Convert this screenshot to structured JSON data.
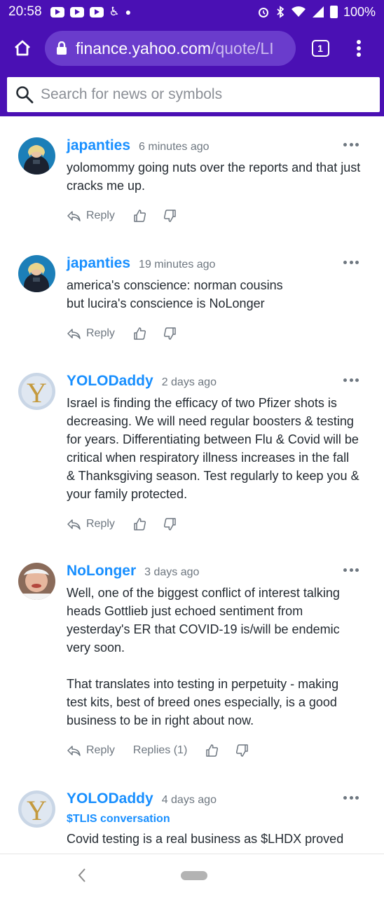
{
  "status_bar": {
    "time": "20:58",
    "battery": "100%",
    "icons": [
      "youtube-icon",
      "youtube-icon",
      "youtube-icon",
      "accessibility-icon",
      "dot-icon",
      "alarm-icon",
      "bluetooth-icon",
      "wifi-icon",
      "signal-icon",
      "battery-icon"
    ]
  },
  "browser": {
    "url_host": "finance.yahoo.com",
    "url_path": "/quote/LI",
    "tab_count": "1",
    "icons": {
      "home": "home-icon",
      "lock": "lock-icon",
      "menu": "kebab-menu-icon"
    }
  },
  "search": {
    "placeholder": "Search for news or symbols",
    "icon": "search-icon"
  },
  "colors": {
    "brand_purple": "#4a10b4",
    "username_blue": "#188fff",
    "muted_gray": "#6e7780"
  },
  "comments": [
    {
      "username": "japanties",
      "time": "6 minutes ago",
      "text": "yolomommy going nuts over the reports and that just cracks me up.",
      "reply_label": "Reply",
      "avatar": "performer-avatar"
    },
    {
      "username": "japanties",
      "time": "19 minutes ago",
      "text": "america's conscience: norman cousins\nbut lucira's conscience is NoLonger",
      "reply_label": "Reply",
      "avatar": "performer-avatar"
    },
    {
      "username": "YOLODaddy",
      "time": "2 days ago",
      "text": "Israel is finding the efficacy of two Pfizer shots is decreasing. We will need regular boosters & testing for years. Differentiating between Flu & Covid will be critical when respiratory illness increases in the fall & Thanksgiving season. Test regularly to keep you & your family protected.",
      "reply_label": "Reply",
      "avatar": "letter-y-avatar"
    },
    {
      "username": "NoLonger",
      "time": "3 days ago",
      "text": "Well, one of the biggest conflict of interest talking heads Gottlieb just echoed sentiment from yesterday's ER that COVID-19 is/will be endemic very soon.\n\nThat translates into testing in perpetuity - making test kits, best of breed ones especially, is a good business to be in right about now.",
      "reply_label": "Reply",
      "replies_label": "Replies (1)",
      "avatar": "elderly-person-avatar"
    },
    {
      "username": "YOLODaddy",
      "time": "4 days ago",
      "tag": "$TLIS conversation",
      "text": "Covid testing is a real business as $LHDX proved",
      "avatar": "letter-y-avatar"
    }
  ],
  "nav": {
    "back_icon": "back-chevron-icon",
    "home_icon": "home-pill-icon"
  }
}
